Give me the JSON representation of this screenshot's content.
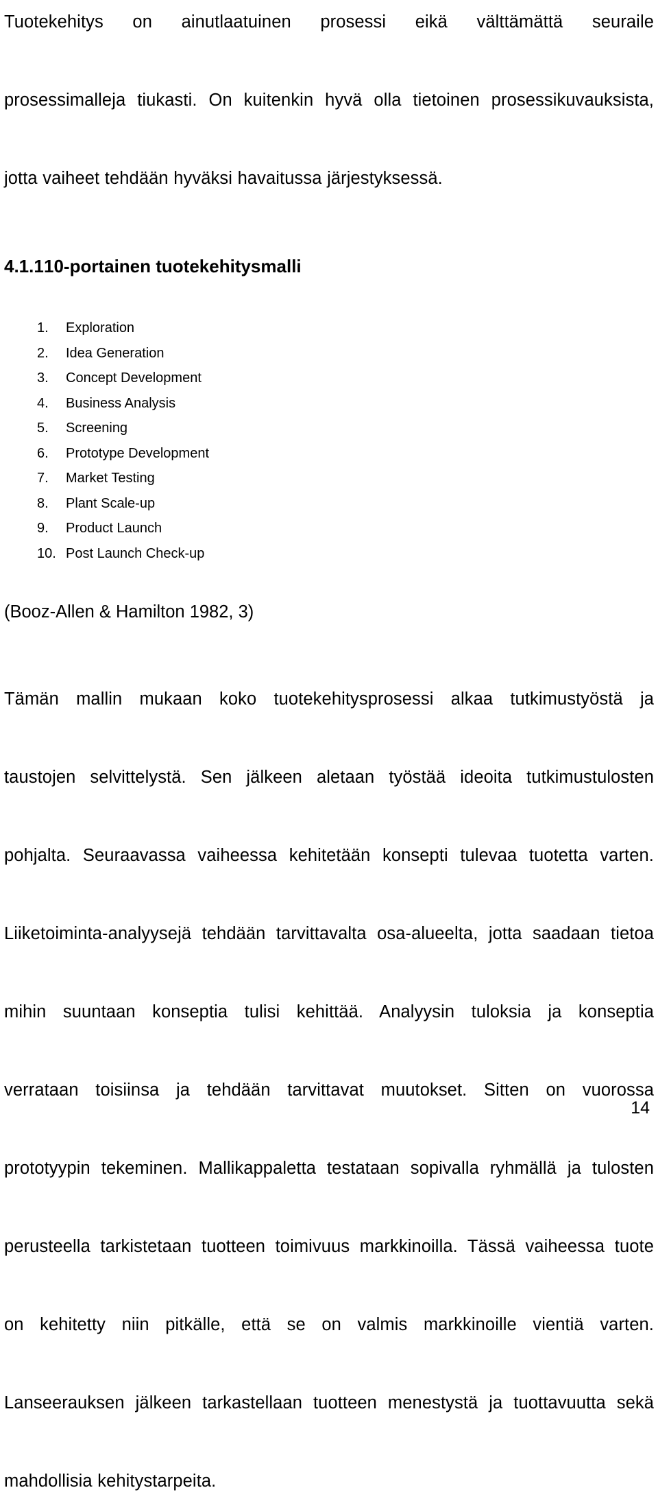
{
  "document": {
    "intro_paragraph": {
      "lines": [
        "Tuotekehitys on ainutlaatuinen prosessi eikä välttämättä seuraile",
        "prosessimalleja tiukasti. On kuitenkin hyvä olla tietoinen prosessikuvauksista,",
        "jotta vaiheet tehdään hyväksi havaitussa järjestyksessä."
      ]
    },
    "heading": {
      "number": "4.1.1",
      "title": "10-portainen tuotekehitysmalli"
    },
    "steps": [
      {
        "number": "1.",
        "label": "Exploration"
      },
      {
        "number": "2.",
        "label": "Idea Generation"
      },
      {
        "number": "3.",
        "label": "Concept Development"
      },
      {
        "number": "4.",
        "label": "Business Analysis"
      },
      {
        "number": "5.",
        "label": "Screening"
      },
      {
        "number": "6.",
        "label": "Prototype Development"
      },
      {
        "number": "7.",
        "label": "Market Testing"
      },
      {
        "number": "8.",
        "label": "Plant Scale-up"
      },
      {
        "number": "9.",
        "label": "Product Launch"
      },
      {
        "number": "10.",
        "label": "Post Launch Check-up"
      }
    ],
    "citation": "(Booz-Allen & Hamilton 1982, 3)",
    "body_paragraph": {
      "lines": [
        "Tämän mallin mukaan koko tuotekehitysprosessi alkaa tutkimustyöstä ja",
        "taustojen selvittelystä. Sen jälkeen aletaan työstää ideoita tutkimustulosten",
        "pohjalta. Seuraavassa vaiheessa kehitetään konsepti tulevaa tuotetta varten.",
        "Liiketoiminta-analyysejä tehdään tarvittavalta osa-alueelta, jotta saadaan tietoa",
        "mihin suuntaan konseptia tulisi kehittää. Analyysin tuloksia ja konseptia",
        "verrataan toisiinsa ja tehdään tarvittavat muutokset. Sitten on vuorossa",
        "prototyypin tekeminen. Mallikappaletta testataan sopivalla ryhmällä ja tulosten",
        "perusteella tarkistetaan tuotteen toimivuus markkinoilla. Tässä vaiheessa tuote",
        "on kehitetty niin pitkälle, että se on valmis markkinoille vientiä varten.",
        "Lanseerauksen jälkeen tarkastellaan tuotteen menestystä ja tuottavuutta sekä",
        "mahdollisia kehitystarpeita."
      ]
    },
    "page_number": "14"
  }
}
